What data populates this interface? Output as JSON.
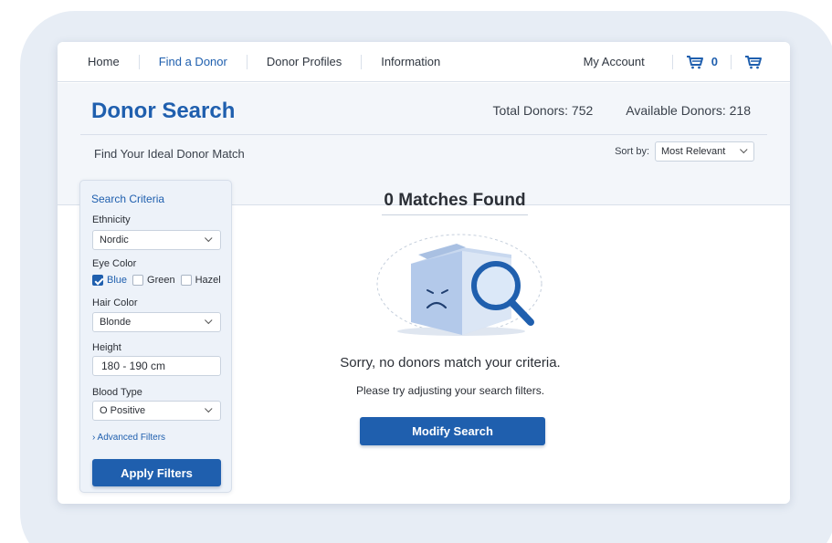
{
  "nav": {
    "links": [
      "Home",
      "Find a Donor",
      "Donor Profiles",
      "Information"
    ],
    "active": "Find a Donor",
    "account": "My Account",
    "cart_count": "0",
    "icons": [
      "cart-icon",
      "cart-icon"
    ]
  },
  "header": {
    "title": "Donor Search",
    "total_donors": "Total Donors: 752",
    "available_donors": "Available Donors: 218",
    "subtitle": "Find Your Ideal Donor Match",
    "sort_label": "Sort by:",
    "sort_value": "Most Relevant"
  },
  "sidebar": {
    "title": "Search Criteria",
    "ethnicity_label": "Ethnicity",
    "ethnicity_value": "Nordic",
    "eye_label": "Eye Color",
    "eye_options": [
      {
        "label": "Blue",
        "checked": true
      },
      {
        "label": "Green",
        "checked": false
      },
      {
        "label": "Hazel",
        "checked": false
      }
    ],
    "hair_label": "Hair Color",
    "hair_value": "Blonde",
    "height_label": "Height",
    "height_value": "180 - 190 cm",
    "blood_label": "Blood Type",
    "blood_value": "O Positive",
    "advanced": "› Advanced Filters",
    "apply": "Apply Filters"
  },
  "results": {
    "title": "0 Matches Found",
    "message": "Sorry, no donors match your criteria.",
    "hint": "Please try adjusting your search filters.",
    "modify": "Modify Search",
    "illustration": "empty-folder-search-icon"
  },
  "colors": {
    "accent": "#1f5fae",
    "background": "#e7edf5",
    "header_band": "#f3f6fa"
  }
}
